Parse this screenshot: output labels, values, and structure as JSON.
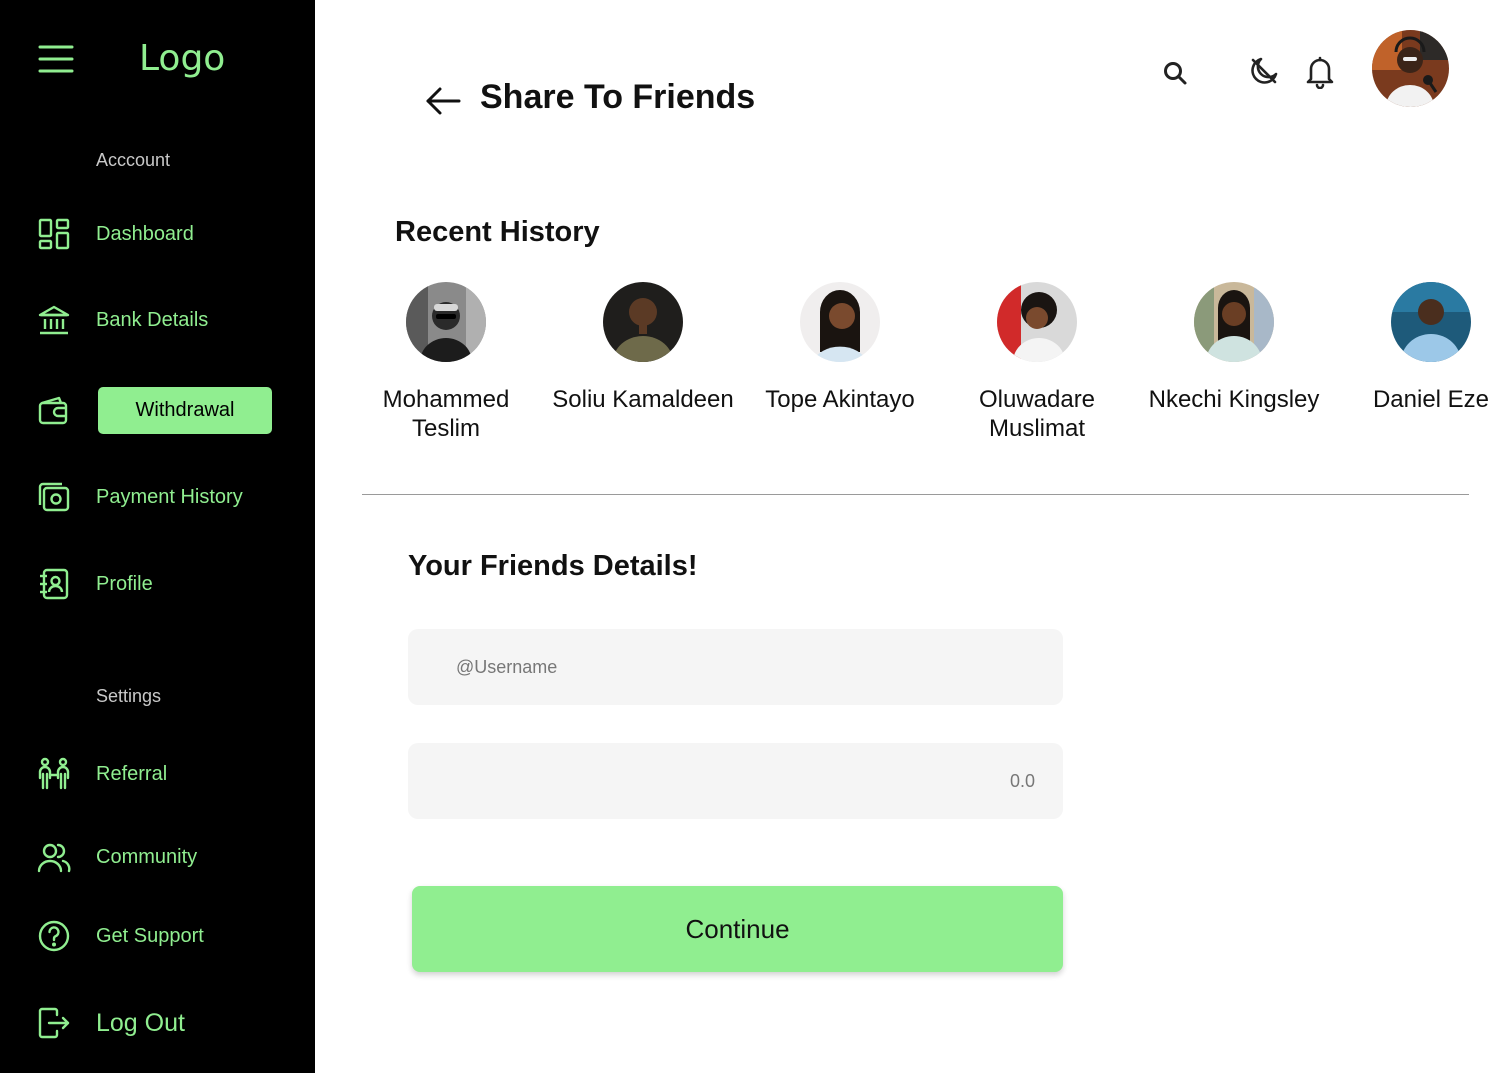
{
  "sidebar": {
    "logo": "Logo",
    "account_label": "Acccount",
    "settings_label": "Settings",
    "items": [
      {
        "label": "Dashboard",
        "icon": "dashboard-icon"
      },
      {
        "label": "Bank Details",
        "icon": "bank-icon"
      },
      {
        "label": "Withdrawal",
        "icon": "wallet-icon",
        "active": true
      },
      {
        "label": "Payment History",
        "icon": "payment-history-icon"
      },
      {
        "label": "Profile",
        "icon": "profile-icon"
      },
      {
        "label": "Referral",
        "icon": "referral-icon"
      },
      {
        "label": "Community",
        "icon": "community-icon"
      },
      {
        "label": "Get Support",
        "icon": "help-icon"
      },
      {
        "label": "Log Out",
        "icon": "logout-icon"
      }
    ]
  },
  "header": {
    "title": "Share To Friends",
    "icons": [
      "back-arrow-icon",
      "search-icon",
      "dark-mode-icon",
      "bell-icon",
      "user-avatar"
    ]
  },
  "recent_history": {
    "title": "Recent History",
    "friends": [
      {
        "name": "Mohammed Teslim"
      },
      {
        "name": "Soliu Kamaldeen"
      },
      {
        "name": "Tope Akintayo"
      },
      {
        "name": "Oluwadare Muslimat"
      },
      {
        "name": "Nkechi Kingsley"
      },
      {
        "name": "Daniel Eze"
      }
    ]
  },
  "form": {
    "title": "Your Friends Details!",
    "username_placeholder": "@Username",
    "amount_placeholder": "0.0",
    "continue_label": "Continue"
  },
  "colors": {
    "accent": "#90ee90",
    "sidebar_bg": "#000000",
    "field_bg": "#f5f5f5"
  }
}
